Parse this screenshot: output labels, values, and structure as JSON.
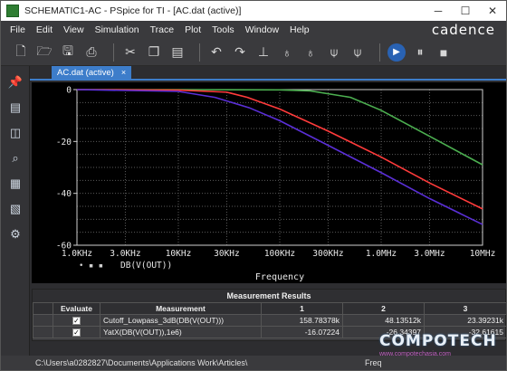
{
  "window": {
    "title": "SCHEMATIC1-AC - PSpice for TI - [AC.dat (active)]",
    "controls": {
      "minimize": "─",
      "maximize": "☐",
      "close": "✕"
    }
  },
  "menu": {
    "items": [
      "File",
      "Edit",
      "View",
      "Simulation",
      "Trace",
      "Plot",
      "Tools",
      "Window",
      "Help"
    ],
    "brand": "cadence"
  },
  "toolbar": {
    "icons": [
      "new-file-icon",
      "open-folder-icon",
      "save-icon",
      "print-icon",
      "cut-icon",
      "copy-icon",
      "paste-icon",
      "undo-icon",
      "redo-icon",
      "probe-icon",
      "marker-icon",
      "marker2-icon",
      "marker3-icon",
      "marker4-icon",
      "run-icon",
      "pause-icon",
      "stop-icon"
    ]
  },
  "sidebar": {
    "icons": [
      "pin-icon",
      "document-icon",
      "measure-icon",
      "zoom-icon",
      "chart-icon",
      "chart2-icon",
      "settings-icon"
    ]
  },
  "tab": {
    "label": "AC.dat (active)",
    "close": "×"
  },
  "chart_data": {
    "type": "line",
    "xscale": "log",
    "xlim": [
      1000,
      10000000
    ],
    "ylim": [
      -60,
      0
    ],
    "xlabel": "Frequency",
    "xtick_labels": [
      "1.0KHz",
      "3.0KHz",
      "10KHz",
      "30KHz",
      "100KHz",
      "300KHz",
      "1.0MHz",
      "3.0MHz",
      "10MHz"
    ],
    "xtick_values": [
      1000,
      3000,
      10000,
      30000,
      100000,
      300000,
      1000000,
      3000000,
      10000000
    ],
    "ytick_labels": [
      "0",
      "-20",
      "-40",
      "-60"
    ],
    "ytick_values": [
      0,
      -20,
      -40,
      -60
    ],
    "grid": true,
    "series": [
      {
        "name": "",
        "color": "#4caf50",
        "x": [
          1000,
          10000,
          100000,
          200000,
          500000,
          1000000,
          3000000,
          10000000
        ],
        "y": [
          0,
          0,
          -0.1,
          -0.5,
          -3,
          -8,
          -18,
          -29
        ]
      },
      {
        "name": "",
        "color": "#ff3b3b",
        "x": [
          1000,
          10000,
          30000,
          48000,
          100000,
          300000,
          1000000,
          3000000,
          10000000
        ],
        "y": [
          0,
          -0.2,
          -1,
          -3,
          -7.5,
          -16,
          -26,
          -36,
          -46
        ]
      },
      {
        "name": "",
        "color": "#5a2fd6",
        "x": [
          1000,
          10000,
          23000,
          50000,
          100000,
          300000,
          1000000,
          3000000,
          10000000
        ],
        "y": [
          0,
          -0.7,
          -3,
          -7,
          -12,
          -21.5,
          -32,
          -42,
          -52
        ]
      }
    ],
    "legend": {
      "label": "DB(V(OUT))",
      "marker": "• ▪ ▪"
    }
  },
  "results": {
    "title": "Measurement Results",
    "headers": [
      "Evaluate",
      "Measurement",
      "1",
      "2",
      "3"
    ],
    "rows": [
      {
        "evaluate": "✓",
        "measurement": "Cutoff_Lowpass_3dB(DB(V(OUT)))",
        "v1": "158.78378k",
        "v2": "48.13512k",
        "v3": "23.39231k"
      },
      {
        "evaluate": "✓",
        "measurement": "YatX(DB(V(OUT)),1e6)",
        "v1": "-16.07224",
        "v2": "-26.34397",
        "v3": "-32.61615"
      }
    ]
  },
  "status": {
    "path": "C:\\Users\\a0282827\\Documents\\Applications Work\\Articles\\",
    "freq_label": "Freq"
  },
  "watermark": {
    "line1": "COMPOTECH",
    "line2": "www.compotechasia.com"
  }
}
